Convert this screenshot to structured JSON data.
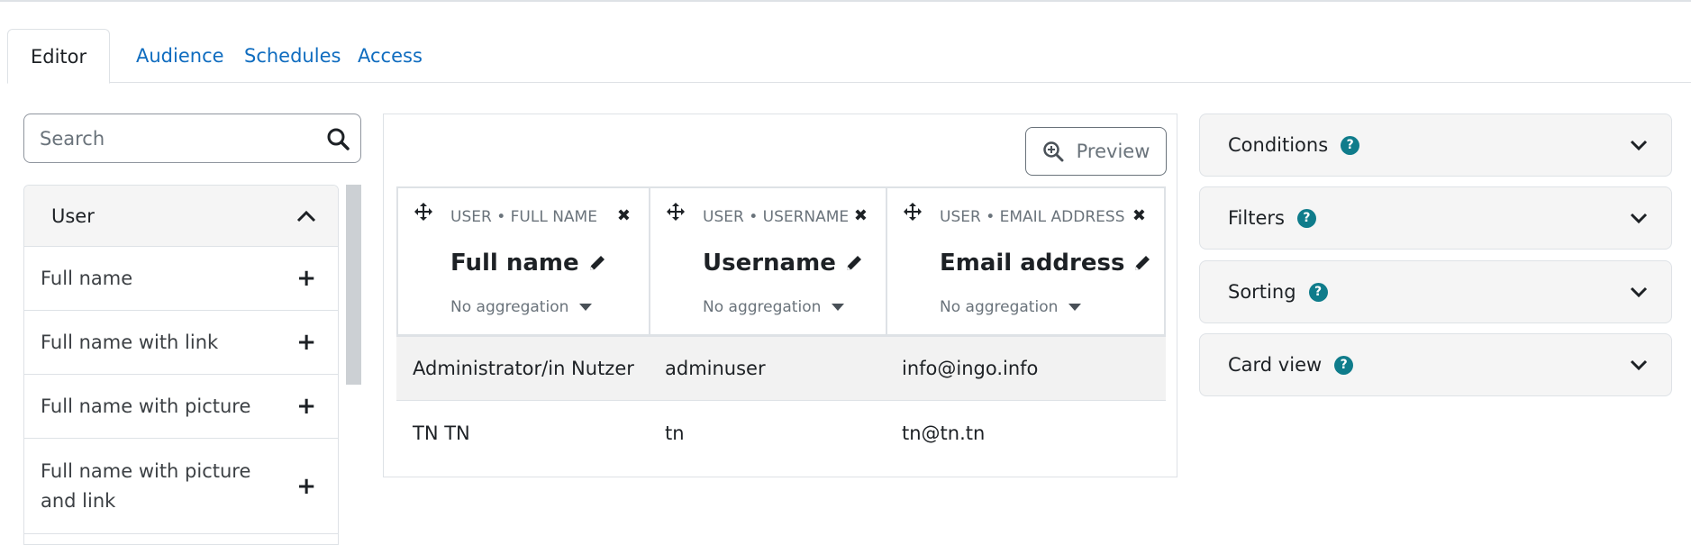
{
  "tabs": [
    {
      "label": "Editor",
      "active": true
    },
    {
      "label": "Audience",
      "active": false
    },
    {
      "label": "Schedules",
      "active": false
    },
    {
      "label": "Access",
      "active": false
    }
  ],
  "search": {
    "placeholder": "Search",
    "icon": "search-icon"
  },
  "sidebar": {
    "section_title": "User",
    "items": [
      {
        "label": "Full name"
      },
      {
        "label": "Full name with link"
      },
      {
        "label": "Full name with picture"
      },
      {
        "label": "Full name with picture and link"
      }
    ]
  },
  "editor": {
    "preview_label": "Preview",
    "columns": [
      {
        "meta": "USER • FULL NAME",
        "title": "Full name",
        "aggregation": "No aggregation"
      },
      {
        "meta": "USER • USERNAME",
        "title": "Username",
        "aggregation": "No aggregation"
      },
      {
        "meta": "USER • EMAIL ADDRESS",
        "title": "Email address",
        "aggregation": "No aggregation"
      }
    ],
    "rows": [
      [
        "Administrator/in Nutzer",
        "adminuser",
        "info@ingo.info"
      ],
      [
        "TN TN",
        "tn",
        "tn@tn.tn"
      ]
    ]
  },
  "panels": [
    {
      "label": "Conditions"
    },
    {
      "label": "Filters"
    },
    {
      "label": "Sorting"
    },
    {
      "label": "Card view"
    }
  ],
  "colors": {
    "link": "#0f6cbf",
    "help": "#0f7c8b",
    "border": "#dee2e6"
  }
}
